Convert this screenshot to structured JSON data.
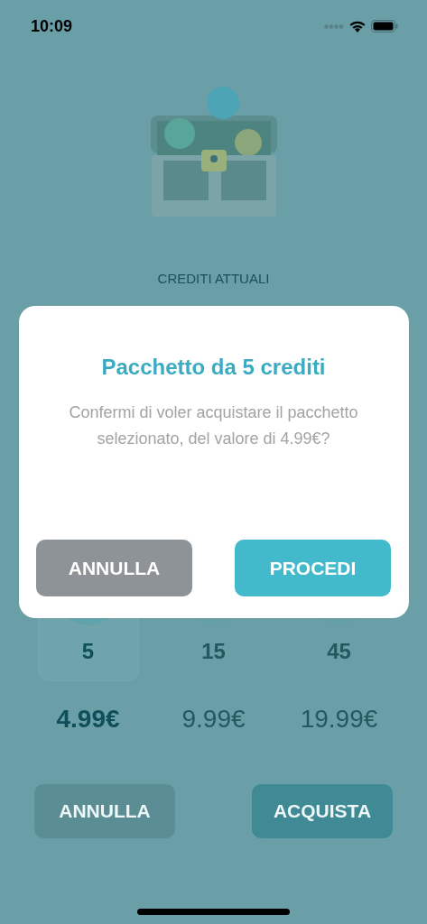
{
  "status_bar": {
    "time": "10:09"
  },
  "balance": {
    "label": "CREDITI ATTUALI"
  },
  "packages": [
    {
      "credits": "5",
      "price": "4.99€",
      "selected": true
    },
    {
      "credits": "15",
      "price": "9.99€",
      "selected": false
    },
    {
      "credits": "45",
      "price": "19.99€",
      "selected": false
    }
  ],
  "actions": [
    {
      "label": "ANNULLA",
      "kind": "secondary"
    },
    {
      "label": "ACQUISTA",
      "kind": "primary"
    }
  ],
  "dialog": {
    "title": "Pacchetto da 5 crediti",
    "message": "Confermi di voler acquistare il pacchetto selezionato, del valore di 4.99€?",
    "buttons": [
      {
        "label": "ANNULLA",
        "kind": "secondary"
      },
      {
        "label": "PROCEDI",
        "kind": "primary"
      }
    ]
  }
}
